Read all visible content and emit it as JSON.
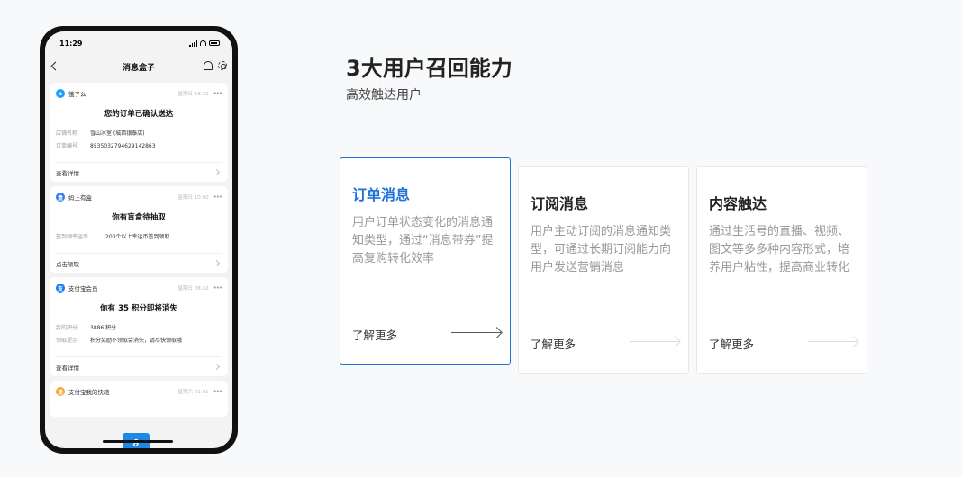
{
  "phone": {
    "time": "11:29",
    "nav_title": "消息盒子",
    "messages": [
      {
        "app": "饿了么",
        "icon_color": "#1e9fff",
        "icon_glyph": "e",
        "time": "星期日 18:32",
        "title": "您的订单已确认送达",
        "rows": [
          {
            "k": "店铺名称",
            "v": "雪山冰室 (城西银泰店)"
          },
          {
            "k": "订单编号",
            "v": "8535032794629142863"
          }
        ],
        "footer": "查看详情"
      },
      {
        "app": "蚂上有盒",
        "icon_color": "#2f7bf5",
        "icon_glyph": "盒",
        "time": "星期日 10:00",
        "title": "你有盲盒待抽取",
        "rows": [
          {
            "k": "签到领幸运币",
            "v": "200个以上幸运币签到领取"
          }
        ],
        "footer": "点击领取"
      },
      {
        "app": "支付宝会员",
        "icon_color": "#1677ff",
        "icon_glyph": "支",
        "time": "星期日 08:32",
        "title": "你有 35 积分即将消失",
        "rows": [
          {
            "k": "我的积分",
            "v": "3886 积分"
          },
          {
            "k": "领取提示",
            "v": "积分奖励不领取会消失，请尽快领取哦"
          }
        ],
        "footer": "查看详情"
      },
      {
        "app": "支付宝我的快递",
        "icon_color": "#f5a623",
        "icon_glyph": "递",
        "time": "星期六 21:01"
      }
    ]
  },
  "headline": "3大用户召回能力",
  "subline": "高效触达用户",
  "features": [
    {
      "title": "订单消息",
      "desc": "用户订单状态变化的消息通知类型，通过“消息带券”提高复购转化效率",
      "more": "了解更多"
    },
    {
      "title": "订阅消息",
      "desc": "用户主动订阅的消息通知类型，可通过长期订阅能力向用户发送营销消息",
      "more": "了解更多"
    },
    {
      "title": "内容触达",
      "desc": "通过生活号的直播、视频、图文等多多种内容形式，培养用户粘性，提高商业转化",
      "more": "了解更多"
    }
  ]
}
